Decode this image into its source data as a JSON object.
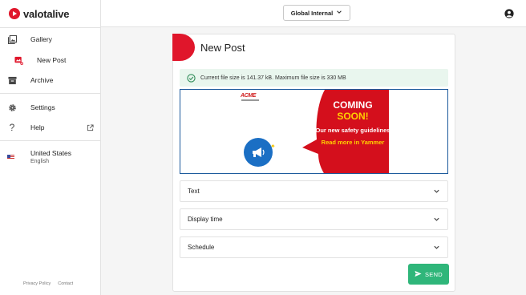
{
  "app": {
    "logo_text": "valotalive",
    "brand_color": "#e0162b"
  },
  "sidebar": {
    "items": [
      {
        "label": "Gallery",
        "icon": "gallery-icon"
      },
      {
        "label": "New Post",
        "icon": "new-post-icon"
      },
      {
        "label": "Archive",
        "icon": "archive-icon"
      },
      {
        "label": "Settings",
        "icon": "gear-icon"
      },
      {
        "label": "Help",
        "icon": "help-icon"
      }
    ],
    "locale": {
      "country": "United States",
      "language": "English"
    },
    "footer": {
      "privacy": "Privacy Policy",
      "contact": "Contact"
    }
  },
  "topbar": {
    "workspace": "Global Internal"
  },
  "post": {
    "title": "New Post",
    "notice": "Current file size is 141.37 kB. Maximum file size is 330 MB",
    "preview": {
      "brand": "ACME",
      "line1": "COMING",
      "line2": "SOON!",
      "line3": "Our new safety guidelines",
      "line4": "Read more in Yammer"
    },
    "sections": [
      "Text",
      "Display time",
      "Schedule"
    ],
    "send_label": "SEND",
    "send_color": "#2fb67a"
  }
}
